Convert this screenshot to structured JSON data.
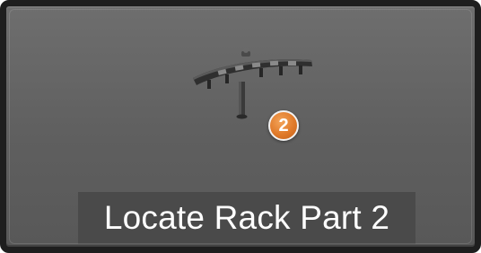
{
  "button": {
    "label": "Locate Rack Part 2",
    "step_number": "2",
    "icon": "rack-part-icon"
  },
  "colors": {
    "tile_background": "#646464",
    "tile_border": "#1e1e1e",
    "label_background": "#4a4a4a",
    "label_text": "#ffffff",
    "badge": "#e07a2a"
  }
}
